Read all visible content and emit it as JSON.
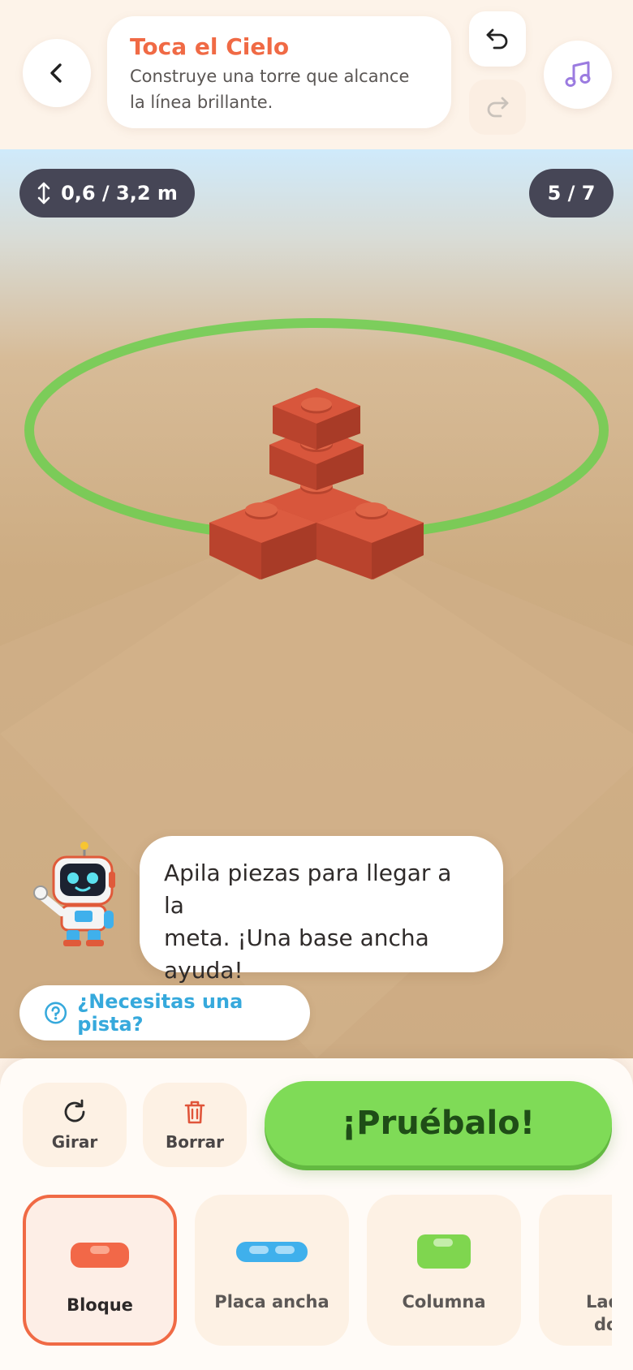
{
  "header": {
    "back_icon": "chevron-left-icon",
    "title": "Toca el Cielo",
    "subtitle_line1": "Construye una torre que alcance",
    "subtitle_line2": "la línea brillante.",
    "undo_icon": "undo-icon",
    "redo_icon": "redo-icon",
    "music_icon": "music-note-icon"
  },
  "scene": {
    "height_readout": "0,6 / 3,2 m",
    "height_icon": "vertical-arrows-icon",
    "pieces_counter": "5 / 7",
    "goal_ring_color": "#6ccf4f",
    "brick_color": "#d3533a",
    "assistant": {
      "speech_line1": "Apila piezas para llegar a la",
      "speech_line2": "meta. ¡Una base ancha",
      "speech_line3": "ayuda!"
    },
    "hint_label": "¿Necesitas una pista?",
    "hint_icon": "question-circle-icon"
  },
  "toolbar": {
    "rotate_label": "Girar",
    "rotate_icon": "rotate-icon",
    "delete_label": "Borrar",
    "delete_icon": "trash-icon",
    "try_label": "¡Pruébalo!",
    "try_color": "#7fdb57"
  },
  "pieces": [
    {
      "label": "Bloque",
      "label2": "",
      "color": "#f26848",
      "selected": true
    },
    {
      "label": "Placa ancha",
      "label2": "",
      "color": "#3fb0ec",
      "selected": false
    },
    {
      "label": "Columna",
      "label2": "",
      "color": "#7fd64f",
      "selected": false
    },
    {
      "label": "Lad",
      "label2": "do",
      "color": "#f27c93",
      "selected": false
    }
  ],
  "colors": {
    "accent": "#f06a45",
    "pill_bg": "#464656",
    "hint_text": "#36a9dc",
    "music_icon": "#9b7be0"
  }
}
